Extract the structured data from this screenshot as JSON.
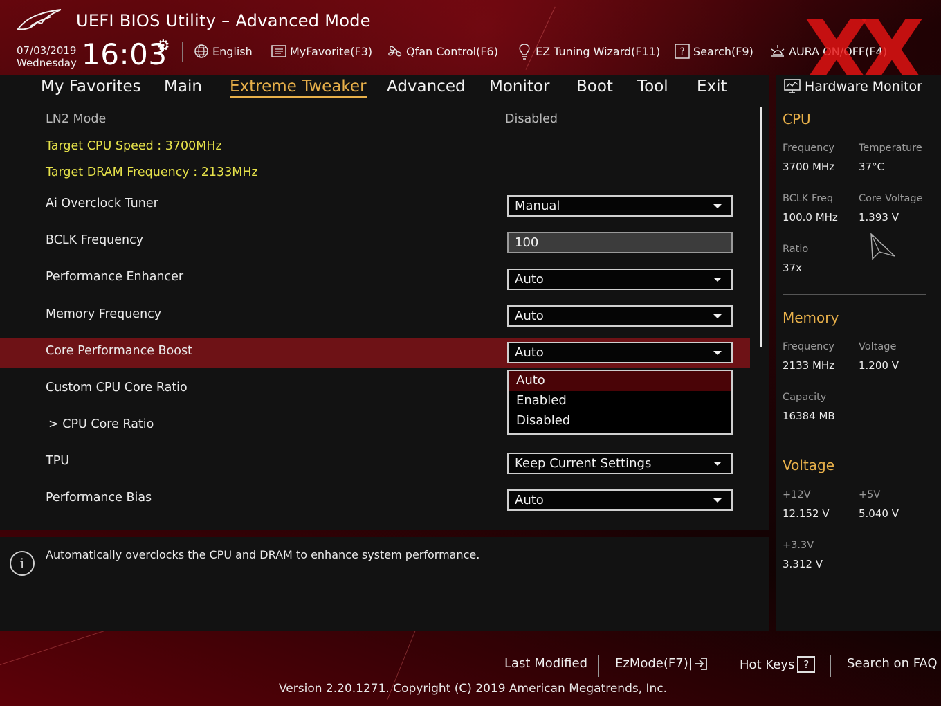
{
  "header": {
    "app_title": "UEFI BIOS Utility – Advanced Mode",
    "date": "07/03/2019",
    "day": "Wednesday",
    "time": "16:03",
    "watermark": "XX"
  },
  "toolbar": [
    {
      "label": "English",
      "icon": "globe-icon"
    },
    {
      "label": "MyFavorite(F3)",
      "icon": "favorite-list-icon"
    },
    {
      "label": "Qfan Control(F6)",
      "icon": "fan-icon"
    },
    {
      "label": "EZ Tuning Wizard(F11)",
      "icon": "lightbulb-icon"
    },
    {
      "label": "Search(F9)",
      "icon": "help-box-icon"
    },
    {
      "label": "AURA ON/OFF(F4)",
      "icon": "aura-light-icon"
    }
  ],
  "nav": {
    "tabs": [
      "My Favorites",
      "Main",
      "Extreme Tweaker",
      "Advanced",
      "Monitor",
      "Boot",
      "Tool",
      "Exit"
    ],
    "active": "Extreme Tweaker"
  },
  "main": {
    "ln2_label": "LN2 Mode",
    "ln2_value": "Disabled",
    "target_cpu": "Target CPU Speed : 3700MHz",
    "target_dram": "Target DRAM Frequency : 2133MHz",
    "settings": [
      {
        "label": "Ai Overclock Tuner",
        "value": "Manual"
      },
      {
        "label": "BCLK Frequency",
        "value": "100"
      },
      {
        "label": "Performance Enhancer",
        "value": "Auto"
      },
      {
        "label": "Memory Frequency",
        "value": "Auto"
      },
      {
        "label": "Core Performance Boost",
        "value": "Auto"
      },
      {
        "label": "Custom CPU Core Ratio",
        "value": ""
      },
      {
        "label": "> CPU Core Ratio",
        "value": ""
      },
      {
        "label": "TPU",
        "value": "Keep Current Settings"
      },
      {
        "label": "Performance Bias",
        "value": "Auto"
      }
    ],
    "dropdown_options": [
      "Auto",
      "Enabled",
      "Disabled"
    ],
    "dropdown_selected": "Auto"
  },
  "help": {
    "text": "Automatically overclocks the CPU and DRAM to enhance system performance."
  },
  "hw_monitor": {
    "title": "Hardware Monitor",
    "cpu": {
      "title": "CPU",
      "frequency_label": "Frequency",
      "frequency": "3700 MHz",
      "temperature_label": "Temperature",
      "temperature": "37°C",
      "bclk_label": "BCLK Freq",
      "bclk": "100.0 MHz",
      "core_voltage_label": "Core Voltage",
      "core_voltage": "1.393 V",
      "ratio_label": "Ratio",
      "ratio": "37x"
    },
    "memory": {
      "title": "Memory",
      "frequency_label": "Frequency",
      "frequency": "2133 MHz",
      "voltage_label": "Voltage",
      "voltage": "1.200 V",
      "capacity_label": "Capacity",
      "capacity": "16384 MB"
    },
    "voltage": {
      "title": "Voltage",
      "v12_label": "+12V",
      "v12": "12.152 V",
      "v5_label": "+5V",
      "v5": "5.040 V",
      "v33_label": "+3.3V",
      "v33": "3.312 V"
    }
  },
  "footer": {
    "last_modified": "Last Modified",
    "ezmode": "EzMode(F7)|",
    "hot_keys": "Hot Keys",
    "hot_keys_key": "?",
    "faq": "Search on FAQ",
    "version": "Version 2.20.1271. Copyright (C) 2019 American Megatrends, Inc."
  },
  "colors": {
    "accent": "#e8b04a",
    "highlight": "#6e1216",
    "target_text": "#e6e24a",
    "panel": "#121212"
  }
}
